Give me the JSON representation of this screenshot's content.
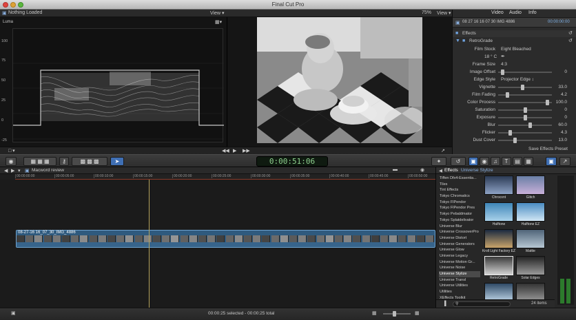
{
  "window": {
    "title": "Final Cut Pro"
  },
  "viewer": {
    "event_label": "Nothing Loaded",
    "scope_menu": "View ▾",
    "zoom": "75%",
    "view_menu": "View ▾",
    "scope_channel": "Luma",
    "scope_ticks": [
      "100",
      "75",
      "50",
      "25",
      "0",
      "-25"
    ]
  },
  "inspector": {
    "tabs": {
      "video": "Video",
      "audio": "Audio",
      "info": "Info"
    },
    "clip_name": "08 27 16 16 07 30 IMG 4886",
    "clip_time": "00:00:00:00",
    "section_effects": "Effects",
    "section_retrograde": "RetroGrade",
    "film_stock_label": "Film Stock",
    "film_stock_value": "Eight Bleached",
    "film_temp_label": "18 ° C",
    "frame_size_label": "Frame Size",
    "frame_size_value": "4:3",
    "rows": [
      {
        "label": "Image Offset",
        "value": "0",
        "pct": 0.05
      },
      {
        "label": "Edge Style",
        "value": "Projector Edge ↕",
        "pct": null
      },
      {
        "label": "Vignette",
        "value": "33.0",
        "pct": 0.45
      },
      {
        "label": "Film Fading",
        "value": "4.2",
        "pct": 0.15
      },
      {
        "label": "Color Process",
        "value": "100.0",
        "pct": 0.95
      },
      {
        "label": "Saturation",
        "value": "0",
        "pct": 0.5
      },
      {
        "label": "Exposure",
        "value": "0",
        "pct": 0.5
      },
      {
        "label": "Blur",
        "value": "60.0",
        "pct": 0.6
      },
      {
        "label": "Flicker",
        "value": "4.3",
        "pct": 0.2
      },
      {
        "label": "Dust Cover",
        "value": "13.0",
        "pct": 0.3
      }
    ],
    "save_preset": "Save Effects Preset"
  },
  "toolbar": {
    "timecode": "0:00:51:06"
  },
  "timeline": {
    "project_name": "Macword review",
    "ruler_labels": [
      "00:00:00:00",
      "00:00:05:00",
      "00:00:10:00",
      "00:00:15:00",
      "00:00:20:00",
      "00:00:25:00",
      "00:00:30:00",
      "00:00:35:00",
      "00:00:40:00",
      "00:00:45:00",
      "00:00:50:00"
    ],
    "clip_label": "08-27-16 16_07_30_IMG_4886"
  },
  "browser": {
    "title": "Effects",
    "breadcrumb": "Universe Stylize",
    "categories": [
      "Tiffen Dfx4-Essentia...",
      "Tiles",
      "Tint Effects",
      "Tokyo Chromatics",
      "Tokyo FlPendor",
      "Tokyo FlPendor Pres",
      "Tokyo Pebaldmator",
      "Tokyo Splatdelivator",
      "Universe Blur",
      "Universe CrossoverPro",
      "Universe Distort",
      "Universe Generators",
      "Universe Glow",
      "Universe Legacy",
      "Universe Motion Gr...",
      "Universe Noise",
      "Universe Stylize",
      "Universe Transl",
      "Universe Utilities",
      "Utilities",
      "XEffects Toolkit"
    ],
    "selected_category": "Universe Stylize",
    "thumbnails": [
      "Chrocont",
      "Glitch",
      "Halftone",
      "Halftone EZ",
      "Kroll Light Factory EZ",
      "Mattte",
      "RetroGrade",
      "Solar Edges",
      "",
      ""
    ],
    "item_count": "24 items"
  },
  "status": {
    "selection": "00:00:25 selected - 00:00:25 total"
  },
  "colors": {
    "accent_blue": "#3f6fb4",
    "clip_blue": "#2f5a7e",
    "timecode_green": "#8ed08e",
    "playhead": "#b5a35c"
  }
}
